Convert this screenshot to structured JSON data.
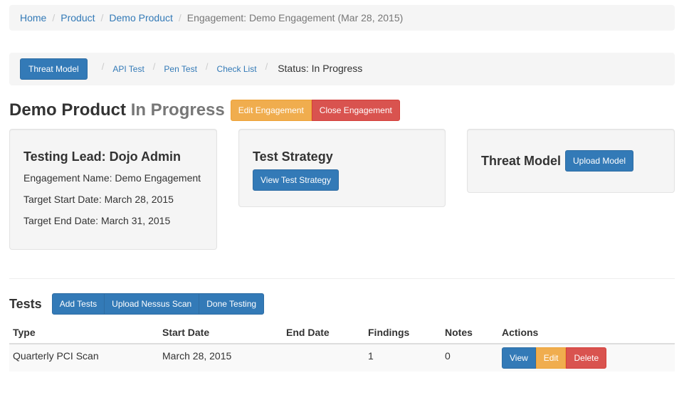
{
  "breadcrumb": {
    "items": [
      "Home",
      "Product",
      "Demo Product"
    ],
    "current": "Engagement: Demo Engagement (Mar 28, 2015)"
  },
  "subnav": {
    "active_button": "Threat Model",
    "links": [
      "API Test",
      "Pen Test",
      "Check List"
    ],
    "status": "Status: In Progress"
  },
  "header": {
    "product": "Demo Product",
    "status": "In Progress",
    "edit_button": "Edit Engagement",
    "close_button": "Close Engagement"
  },
  "lead_panel": {
    "title": "Testing Lead: Dojo Admin",
    "engagement_name": "Engagement Name: Demo Engagement",
    "target_start": "Target Start Date: March 28, 2015",
    "target_end": "Target End Date: March 31, 2015"
  },
  "strategy_panel": {
    "title": "Test Strategy",
    "button": "View Test Strategy"
  },
  "threat_panel": {
    "title": "Threat Model",
    "button": "Upload Model"
  },
  "tests": {
    "title": "Tests",
    "buttons": [
      "Add Tests",
      "Upload Nessus Scan",
      "Done Testing"
    ],
    "columns": [
      "Type",
      "Start Date",
      "End Date",
      "Findings",
      "Notes",
      "Actions"
    ],
    "rows": [
      {
        "type": "Quarterly PCI Scan",
        "start_date": "March 28, 2015",
        "end_date": "",
        "findings": "1",
        "notes": "0",
        "actions": [
          "View",
          "Edit",
          "Delete"
        ]
      }
    ]
  },
  "colors": {
    "primary": "#337ab7",
    "warning": "#f0ad4e",
    "danger": "#d9534f",
    "well_bg": "#f5f5f5"
  }
}
